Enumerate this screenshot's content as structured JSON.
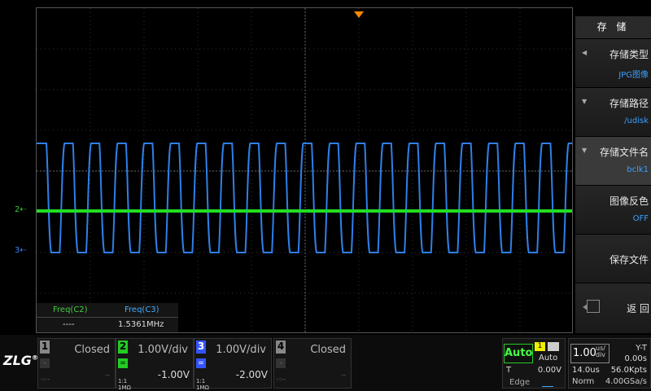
{
  "scope": {
    "trigger_marker": "trigger-position",
    "channel_markers": {
      "ch2": "2",
      "ch3": "3"
    },
    "colors": {
      "ch2": "#22dd22",
      "ch3": "#2f7fe8",
      "trigger": "#ff8800"
    }
  },
  "measure": {
    "headers": [
      "Freq(C2)",
      "Freq(C3)"
    ],
    "values": [
      "----",
      "1.5361MHz"
    ]
  },
  "menu": {
    "title": "存 储",
    "items": [
      {
        "label": "存储类型",
        "value": "JPG图像"
      },
      {
        "label": "存储路径",
        "value": "/udisk"
      },
      {
        "label": "存储文件名",
        "value": "bclk1"
      },
      {
        "label": "图像反色",
        "value": "OFF"
      },
      {
        "label": "保存文件",
        "value": ""
      },
      {
        "label": "返 回",
        "value": ""
      }
    ]
  },
  "bottom": {
    "logo": "ZLG",
    "logo_mark": "®",
    "channels": [
      {
        "num": "1",
        "state": "Closed",
        "offset": "--",
        "dots": "-:--"
      },
      {
        "num": "2",
        "state": "1.00V/div",
        "offset": "-1.00V",
        "imp": "1:1\n1MΩ"
      },
      {
        "num": "3",
        "state": "1.00V/div",
        "offset": "-2.00V",
        "imp": "1:1\n1MΩ"
      },
      {
        "num": "4",
        "state": "Closed",
        "offset": "--",
        "dots": "-:--"
      }
    ],
    "trigger": {
      "mode_badge": "Auto",
      "source": "1",
      "mode": "Auto",
      "t_label": "T",
      "t_value": "0.00V",
      "type": "Edge"
    },
    "timebase": {
      "scale": "1.00",
      "unit_top": "us/",
      "unit_bot": "div",
      "mode1": "Y-T",
      "mode2": "0.00s",
      "delay": "14.0us",
      "points": "56.0Kpts",
      "acq": "Norm",
      "rate": "4.00GSa/s"
    }
  }
}
